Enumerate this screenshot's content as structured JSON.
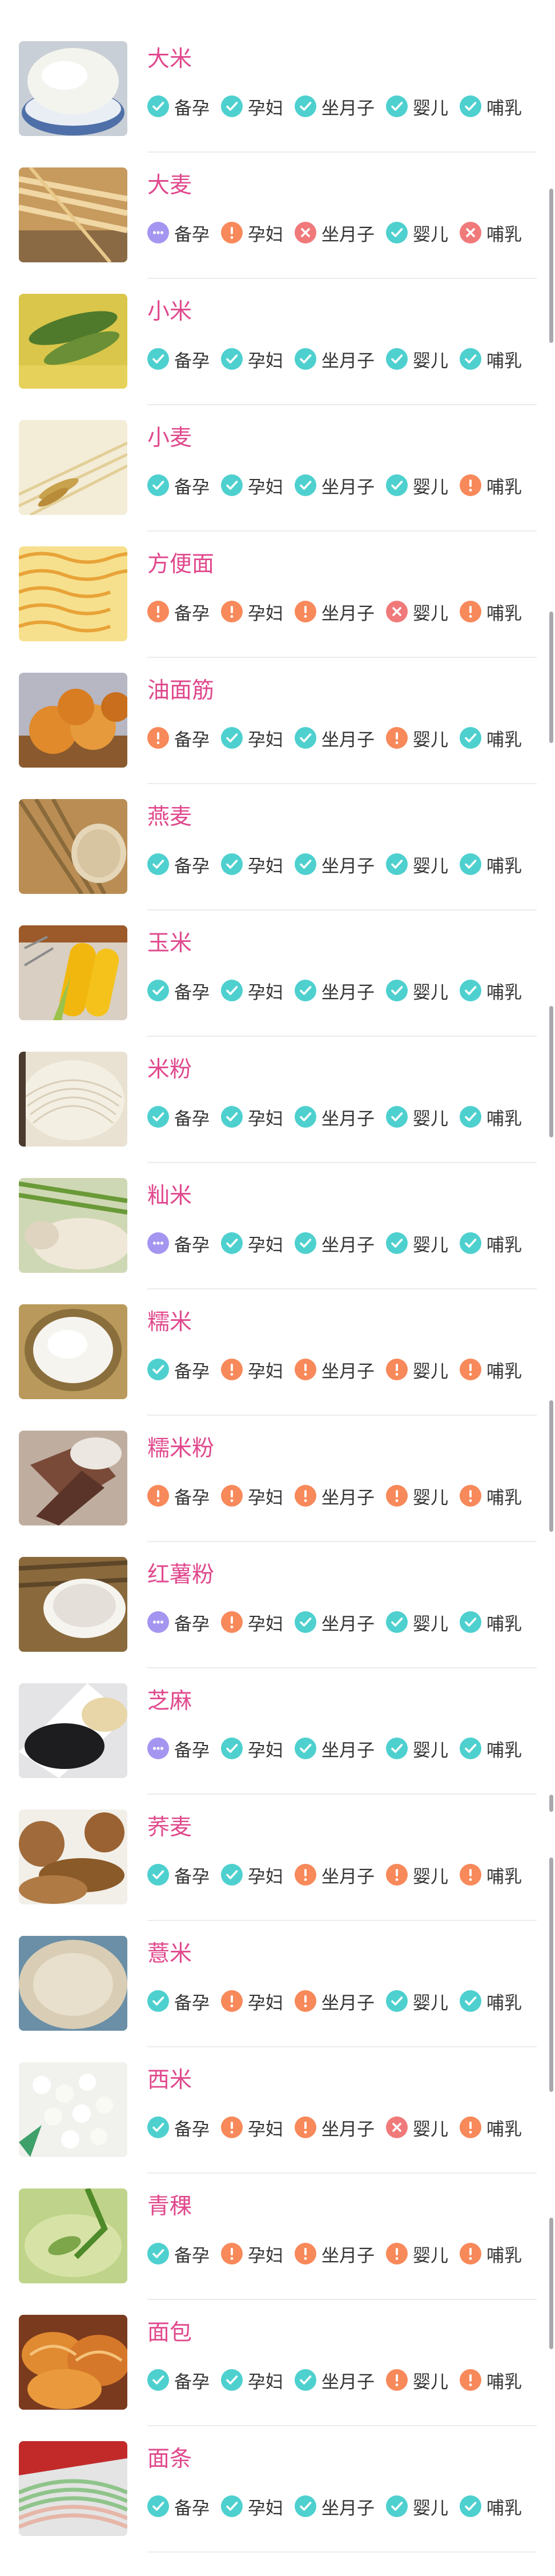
{
  "status_labels": [
    "备孕",
    "孕妇",
    "坐月子",
    "婴儿",
    "哺乳"
  ],
  "colors": {
    "name": "#e0498d",
    "ok": "#4ed0cf",
    "caution": "#f7895a",
    "forbidden": "#f07a7a",
    "unknown": "#a496f0"
  },
  "foods": [
    {
      "name": "大米",
      "image": "rice-bowl-photo",
      "status": [
        "ok",
        "ok",
        "ok",
        "ok",
        "ok"
      ]
    },
    {
      "name": "大麦",
      "image": "barley-photo",
      "status": [
        "unknown",
        "caution",
        "forbidden",
        "ok",
        "forbidden"
      ]
    },
    {
      "name": "小米",
      "image": "millet-photo",
      "status": [
        "ok",
        "ok",
        "ok",
        "ok",
        "ok"
      ]
    },
    {
      "name": "小麦",
      "image": "wheat-photo",
      "status": [
        "ok",
        "ok",
        "ok",
        "ok",
        "caution"
      ]
    },
    {
      "name": "方便面",
      "image": "instant-noodles-photo",
      "status": [
        "caution",
        "caution",
        "caution",
        "forbidden",
        "caution"
      ]
    },
    {
      "name": "油面筋",
      "image": "fried-gluten-photo",
      "status": [
        "caution",
        "ok",
        "ok",
        "caution",
        "ok"
      ]
    },
    {
      "name": "燕麦",
      "image": "oats-photo",
      "status": [
        "ok",
        "ok",
        "ok",
        "ok",
        "ok"
      ]
    },
    {
      "name": "玉米",
      "image": "corn-photo",
      "status": [
        "ok",
        "ok",
        "ok",
        "ok",
        "ok"
      ]
    },
    {
      "name": "米粉",
      "image": "rice-noodles-photo",
      "status": [
        "ok",
        "ok",
        "ok",
        "ok",
        "ok"
      ]
    },
    {
      "name": "籼米",
      "image": "indica-rice-photo",
      "status": [
        "unknown",
        "ok",
        "ok",
        "ok",
        "ok"
      ]
    },
    {
      "name": "糯米",
      "image": "glutinous-rice-photo",
      "status": [
        "ok",
        "caution",
        "caution",
        "caution",
        "caution"
      ]
    },
    {
      "name": "糯米粉",
      "image": "glutinous-flour-photo",
      "status": [
        "caution",
        "caution",
        "caution",
        "caution",
        "caution"
      ]
    },
    {
      "name": "红薯粉",
      "image": "sweet-potato-starch-photo",
      "status": [
        "unknown",
        "caution",
        "ok",
        "ok",
        "ok"
      ]
    },
    {
      "name": "芝麻",
      "image": "sesame-photo",
      "status": [
        "unknown",
        "ok",
        "ok",
        "ok",
        "ok"
      ]
    },
    {
      "name": "荞麦",
      "image": "buckwheat-photo",
      "status": [
        "ok",
        "ok",
        "caution",
        "caution",
        "caution"
      ]
    },
    {
      "name": "薏米",
      "image": "job-tears-photo",
      "status": [
        "ok",
        "caution",
        "caution",
        "ok",
        "ok"
      ]
    },
    {
      "name": "西米",
      "image": "sago-photo",
      "status": [
        "ok",
        "caution",
        "caution",
        "forbidden",
        "caution"
      ]
    },
    {
      "name": "青稞",
      "image": "highland-barley-photo",
      "status": [
        "ok",
        "caution",
        "caution",
        "caution",
        "caution"
      ]
    },
    {
      "name": "面包",
      "image": "bread-photo",
      "status": [
        "ok",
        "ok",
        "ok",
        "caution",
        "caution"
      ]
    },
    {
      "name": "面条",
      "image": "noodles-photo",
      "status": [
        "ok",
        "ok",
        "ok",
        "ok",
        "ok"
      ]
    }
  ]
}
